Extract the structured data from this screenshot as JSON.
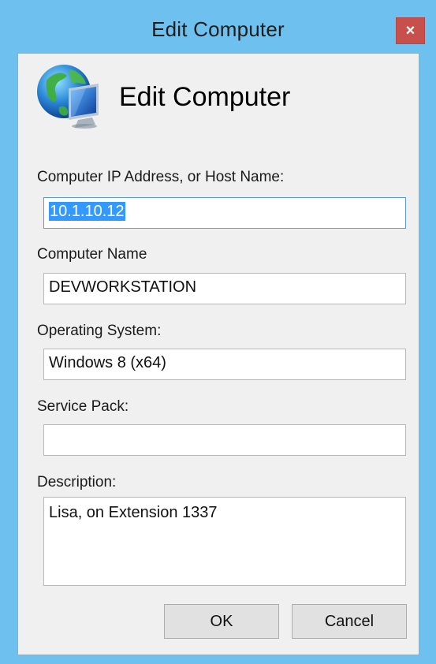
{
  "window": {
    "title": "Edit Computer",
    "close_glyph": "×"
  },
  "header": {
    "heading": "Edit Computer",
    "icon": "globe-monitor-icon"
  },
  "form": {
    "ip_label": "Computer IP Address, or Host Name:",
    "ip_value": "10.1.10.12",
    "name_label": "Computer Name",
    "name_value": "DEVWORKSTATION",
    "os_label": "Operating System:",
    "os_value": "Windows 8 (x64)",
    "sp_label": "Service Pack:",
    "sp_value": "",
    "desc_label": "Description:",
    "desc_value": "Lisa, on Extension 1337"
  },
  "buttons": {
    "ok": "OK",
    "cancel": "Cancel"
  },
  "colors": {
    "title_bar": "#6ec1ee",
    "close_button": "#c7504c",
    "selection": "#3399ff"
  }
}
